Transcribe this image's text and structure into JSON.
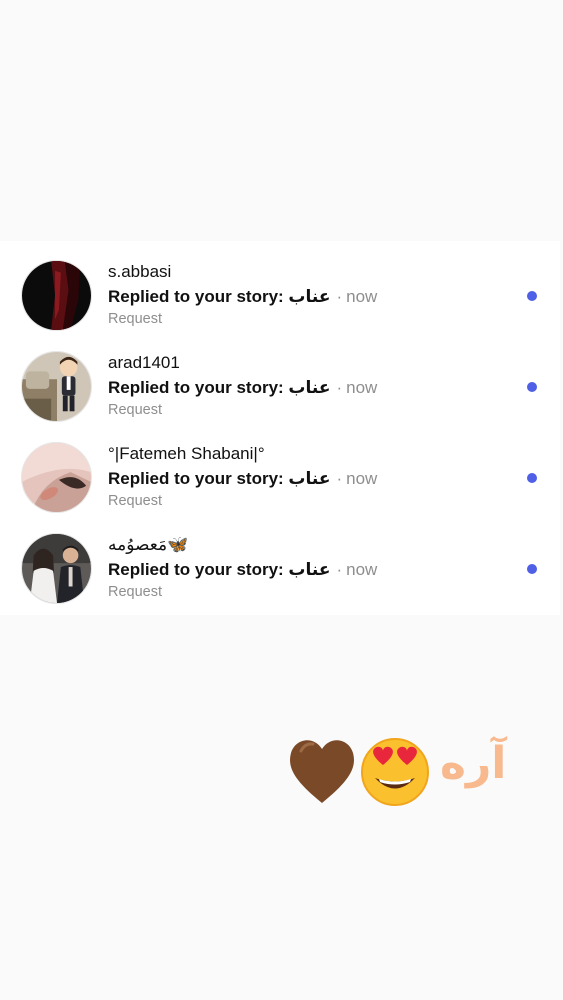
{
  "requests": [
    {
      "username": "s.abbasi",
      "message": "Replied to your story: عناب",
      "separator": "·",
      "time": "now",
      "status": "Request",
      "unread": true
    },
    {
      "username": "arad1401",
      "message": "Replied to your story: عناب",
      "separator": "·",
      "time": "now",
      "status": "Request",
      "unread": true
    },
    {
      "username": "°|Fatemeh Shabani|°",
      "message": "Replied to your story: عناب",
      "separator": "·",
      "time": "now",
      "status": "Request",
      "unread": true
    },
    {
      "username": "مَعصوُمه🦋",
      "message": "Replied to your story: عناب",
      "separator": "·",
      "time": "now",
      "status": "Request",
      "unread": true
    }
  ],
  "sticker": {
    "text": "آره",
    "emojis": [
      "brown-heart",
      "heart-eyes-face"
    ]
  },
  "colors": {
    "unread_dot": "#4f5fe6",
    "secondary_text": "#8e8e8e",
    "sticker_text": "#f7b98d",
    "heart": "#7a4a28",
    "face": "#fbc02d"
  }
}
